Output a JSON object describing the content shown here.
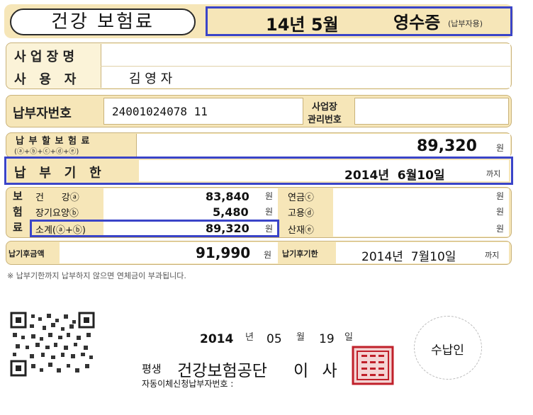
{
  "header": {
    "title": "건강 보험료",
    "period": "14년 5월",
    "receipt": "영수증",
    "receipt_note": "(납부자용)"
  },
  "info": {
    "business_label": "사 업 장 명",
    "business_value": "",
    "user_label": "사   용   자",
    "user_value": "김 영 자"
  },
  "payer": {
    "number_label": "납부자번호",
    "number_value": "24001024078 11",
    "mgmt_label_1": "사업장",
    "mgmt_label_2": "관리번호",
    "mgmt_value": ""
  },
  "amount": {
    "label": "납 부 할 보 험 료",
    "formula": "(ⓐ+ⓑ+ⓒ+ⓓ+ⓔ)",
    "value": "89,320",
    "unit": "원"
  },
  "due": {
    "label": "납   부   기   한",
    "date": "2014년  6월10일",
    "until": "까지"
  },
  "breakdown": {
    "side_label": [
      "보",
      "험",
      "료"
    ],
    "rows": [
      {
        "name": "건      강ⓐ",
        "value": "83,840",
        "unit": "원",
        "name2": "연금ⓒ",
        "value2": "",
        "unit2": "원"
      },
      {
        "name": "장기요양ⓑ",
        "value": "5,480",
        "unit": "원",
        "name2": "고용ⓓ",
        "value2": "",
        "unit2": "원"
      },
      {
        "name": "소계(ⓐ+ⓑ)",
        "value": "89,320",
        "unit": "원",
        "name2": "산재ⓔ",
        "value2": "",
        "unit2": "원"
      }
    ]
  },
  "late": {
    "amount_label": "납기후금액",
    "amount_value": "91,990",
    "amount_unit": "원",
    "due_label": "납기후기한",
    "due_date": "2014년  7월10일",
    "due_until": "까지"
  },
  "notice": "※ 납부기한까지 납부하지 않으면 연체금이 부과됩니다.",
  "footer": {
    "year": "2014",
    "year_unit": "년",
    "month": "05",
    "month_unit": "월",
    "day": "19",
    "day_unit": "일",
    "org_prefix": "평생",
    "org_name": "건강보험공단",
    "chief": "이 사",
    "auto_label": "자동이체신청납부자번호 :",
    "receiver": "수납인"
  },
  "colors": {
    "highlight": "#3a44c8",
    "panel": "#f6e6b8",
    "stamp": "#c0202a"
  }
}
